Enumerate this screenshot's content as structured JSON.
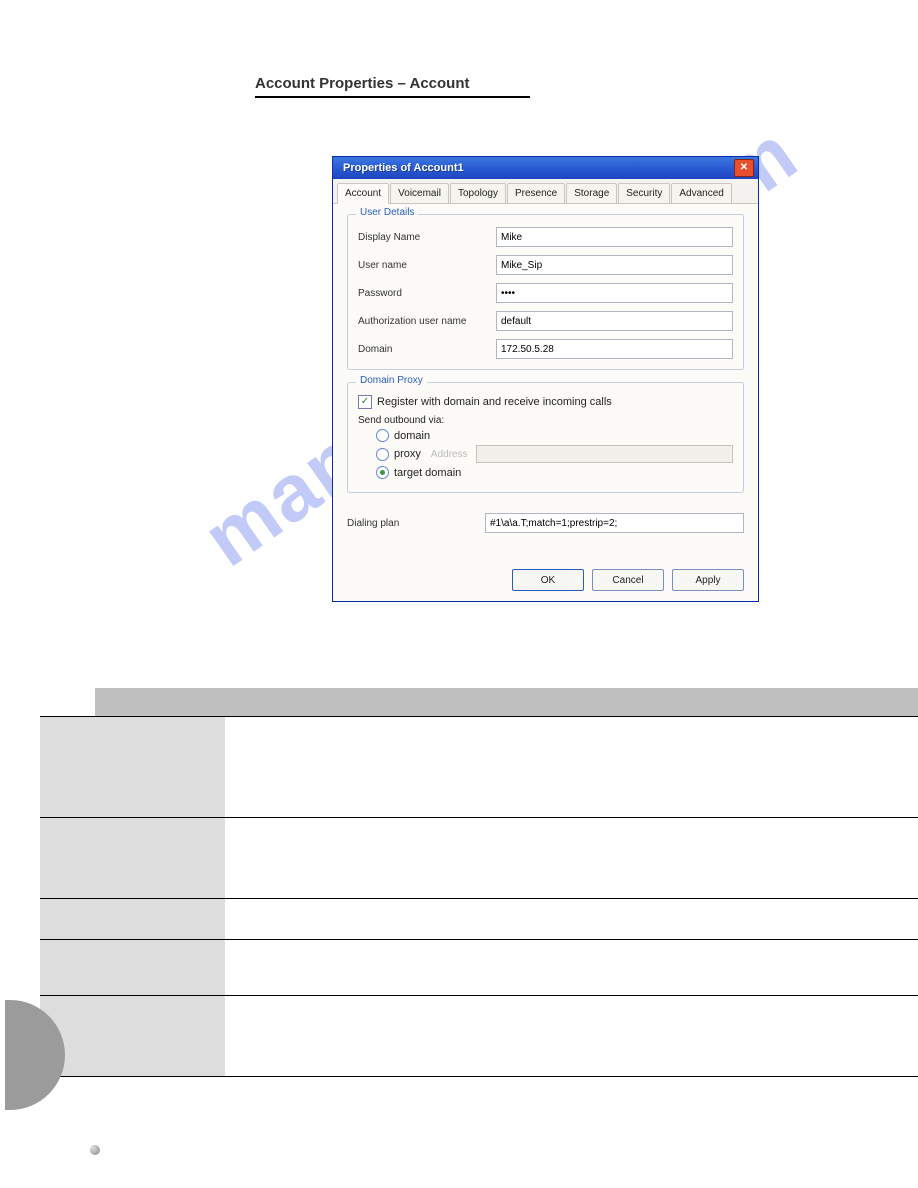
{
  "section_header": "Account Properties – Account",
  "watermark": "manualshive.com",
  "dialog": {
    "title": "Properties of Account1",
    "tabs": [
      "Account",
      "Voicemail",
      "Topology",
      "Presence",
      "Storage",
      "Security",
      "Advanced"
    ],
    "active_tab": 0,
    "user_details": {
      "legend": "User Details",
      "display_name_label": "Display Name",
      "display_name": "Mike",
      "user_name_label": "User name",
      "user_name": "Mike_Sip",
      "password_label": "Password",
      "password": "••••",
      "auth_user_label": "Authorization user name",
      "auth_user": "default",
      "domain_label": "Domain",
      "domain": "172.50.5.28"
    },
    "domain_proxy": {
      "legend": "Domain Proxy",
      "register_label": "Register with domain and receive incoming calls",
      "send_label": "Send outbound via:",
      "opt_domain": "domain",
      "opt_proxy": "proxy",
      "proxy_addr_label": "Address",
      "opt_target": "target domain"
    },
    "dialing_plan_label": "Dialing plan",
    "dialing_plan": "#1\\a\\a.T;match=1;prestrip=2;",
    "buttons": {
      "ok": "OK",
      "cancel": "Cancel",
      "apply": "Apply"
    }
  }
}
